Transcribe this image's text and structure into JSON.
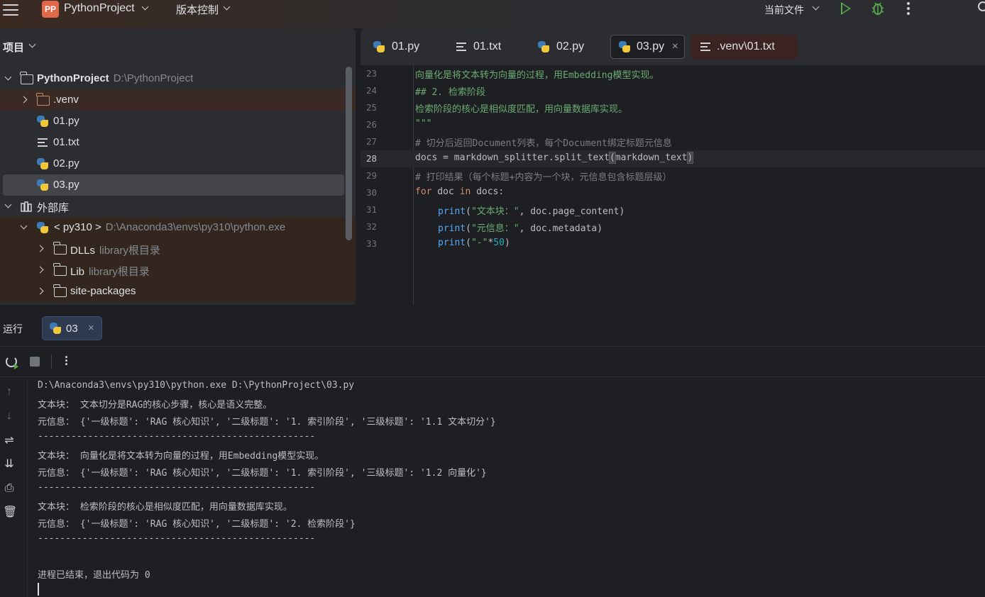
{
  "topbar": {
    "project_badge": "PP",
    "project_name": "PythonProject",
    "vcs_label": "版本控制",
    "current_file_label": "当前文件"
  },
  "project_panel": {
    "title": "项目",
    "tree": [
      {
        "label": "PythonProject",
        "sub": "D:\\PythonProject"
      },
      {
        "label": ".venv",
        "sub": ""
      },
      {
        "label": "01.py",
        "sub": ""
      },
      {
        "label": "01.txt",
        "sub": ""
      },
      {
        "label": "02.py",
        "sub": ""
      },
      {
        "label": "03.py",
        "sub": ""
      },
      {
        "label": "外部库",
        "sub": ""
      },
      {
        "label": "< py310 >",
        "sub": "D:\\Anaconda3\\envs\\py310\\python.exe"
      },
      {
        "label": "DLLs",
        "sub": "library根目录"
      },
      {
        "label": "Lib",
        "sub": "library根目录"
      },
      {
        "label": "site-packages",
        "sub": ""
      }
    ]
  },
  "editor": {
    "tabs": [
      {
        "label": "01.py"
      },
      {
        "label": "01.txt"
      },
      {
        "label": "02.py"
      },
      {
        "label": "03.py",
        "close": "×"
      },
      {
        "label": ".venv\\01.txt"
      }
    ],
    "lines": [
      {
        "num": "23",
        "text": "向量化是将文本转为向量的过程，用Embedding模型实现。"
      },
      {
        "num": "24",
        "text": "## 2. 检索阶段"
      },
      {
        "num": "25",
        "text": "检索阶段的核心是相似度匹配，用向量数据库实现。"
      },
      {
        "num": "26",
        "text": "\"\"\""
      },
      {
        "num": "27",
        "text": "# 切分后返回Document列表，每个Document绑定标题元信息"
      },
      {
        "num": "28",
        "p1": "docs = markdown_splitter.split_text",
        "p2": "(",
        "p3": "markdown_text",
        "p4": ")"
      },
      {
        "num": "29",
        "text": "# 打印结果（每个标题+内容为一个块，元信息包含标题层级）"
      },
      {
        "num": "30",
        "kw1": "for",
        "v1": " doc ",
        "kw2": "in",
        "v2": " docs:"
      },
      {
        "num": "31",
        "fn": "print",
        "a": "(",
        "s": "\"文本块：\"",
        "b": ", doc.page_content)"
      },
      {
        "num": "32",
        "fn": "print",
        "a": "(",
        "s": "\"元信息：\"",
        "b": ", doc.metadata)"
      },
      {
        "num": "33",
        "fn": "print",
        "a": "(",
        "s": "\"-\"",
        "b": "*",
        "n": "50",
        "c": ")"
      }
    ]
  },
  "run_panel": {
    "title": "运行",
    "tab_label": "03",
    "tab_close": "×",
    "console": [
      "D:\\Anaconda3\\envs\\py310\\python.exe D:\\PythonProject\\03.py",
      "文本块： 文本切分是RAG的核心步骤，核心是语义完整。",
      "元信息： {'一级标题': 'RAG 核心知识', '二级标题': '1. 索引阶段', '三级标题': '1.1 文本切分'}",
      "--------------------------------------------------",
      "文本块： 向量化是将文本转为向量的过程，用Embedding模型实现。",
      "元信息： {'一级标题': 'RAG 核心知识', '二级标题': '1. 索引阶段', '三级标题': '1.2 向量化'}",
      "--------------------------------------------------",
      "文本块： 检索阶段的核心是相似度匹配，用向量数据库实现。",
      "元信息： {'一级标题': 'RAG 核心知识', '二级标题': '2. 检索阶段'}",
      "--------------------------------------------------",
      "",
      "进程已结束，退出代码为 0"
    ]
  },
  "colors": {
    "accent_run": "#57a64a",
    "string_green": "#6aab73",
    "keyword": "#cf8e6d",
    "function": "#56a8f5",
    "number": "#2aacb8",
    "comment": "#7a7e85"
  }
}
